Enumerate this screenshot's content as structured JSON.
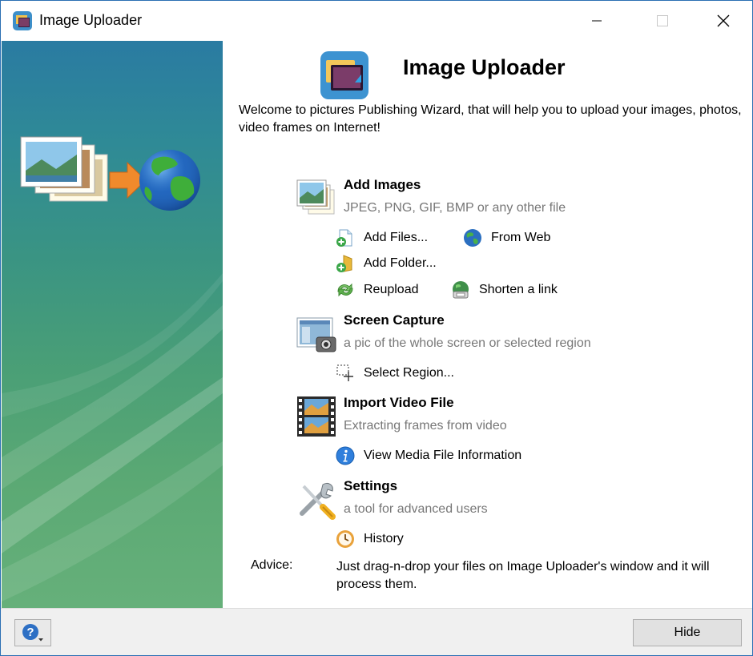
{
  "window": {
    "title": "Image Uploader",
    "controls": [
      "minimize-icon",
      "maximize-icon",
      "close-icon"
    ]
  },
  "header": {
    "title": "Image Uploader",
    "welcome": "Welcome to pictures Publishing Wizard, that will help you to upload your images, photos, video frames on Internet!"
  },
  "sections": {
    "add_images": {
      "title": "Add Images",
      "desc": "JPEG, PNG, GIF, BMP or any other file",
      "links": {
        "add_files": "Add Files...",
        "from_web": "From Web",
        "add_folder": "Add Folder...",
        "reupload": "Reupload",
        "shorten": "Shorten a link"
      }
    },
    "screen_capture": {
      "title": "Screen Capture",
      "desc": "a pic of the whole screen or selected region",
      "links": {
        "select_region": "Select Region..."
      }
    },
    "import_video": {
      "title": "Import Video File",
      "desc": "Extracting frames from video",
      "links": {
        "media_info": "View Media File Information"
      }
    },
    "settings": {
      "title": "Settings",
      "desc": "a tool for advanced users",
      "links": {
        "history": "History"
      }
    }
  },
  "advice": {
    "label": "Advice:",
    "text": "Just drag-n-drop your files on Image Uploader's window and it will process them."
  },
  "footer": {
    "help_icon": "help-icon",
    "hide_label": "Hide"
  },
  "colors": {
    "desc_text": "#777777",
    "banner_top": "#2a7ba2",
    "banner_bottom": "#66b07a",
    "footer_bg": "#f0f0f0"
  }
}
